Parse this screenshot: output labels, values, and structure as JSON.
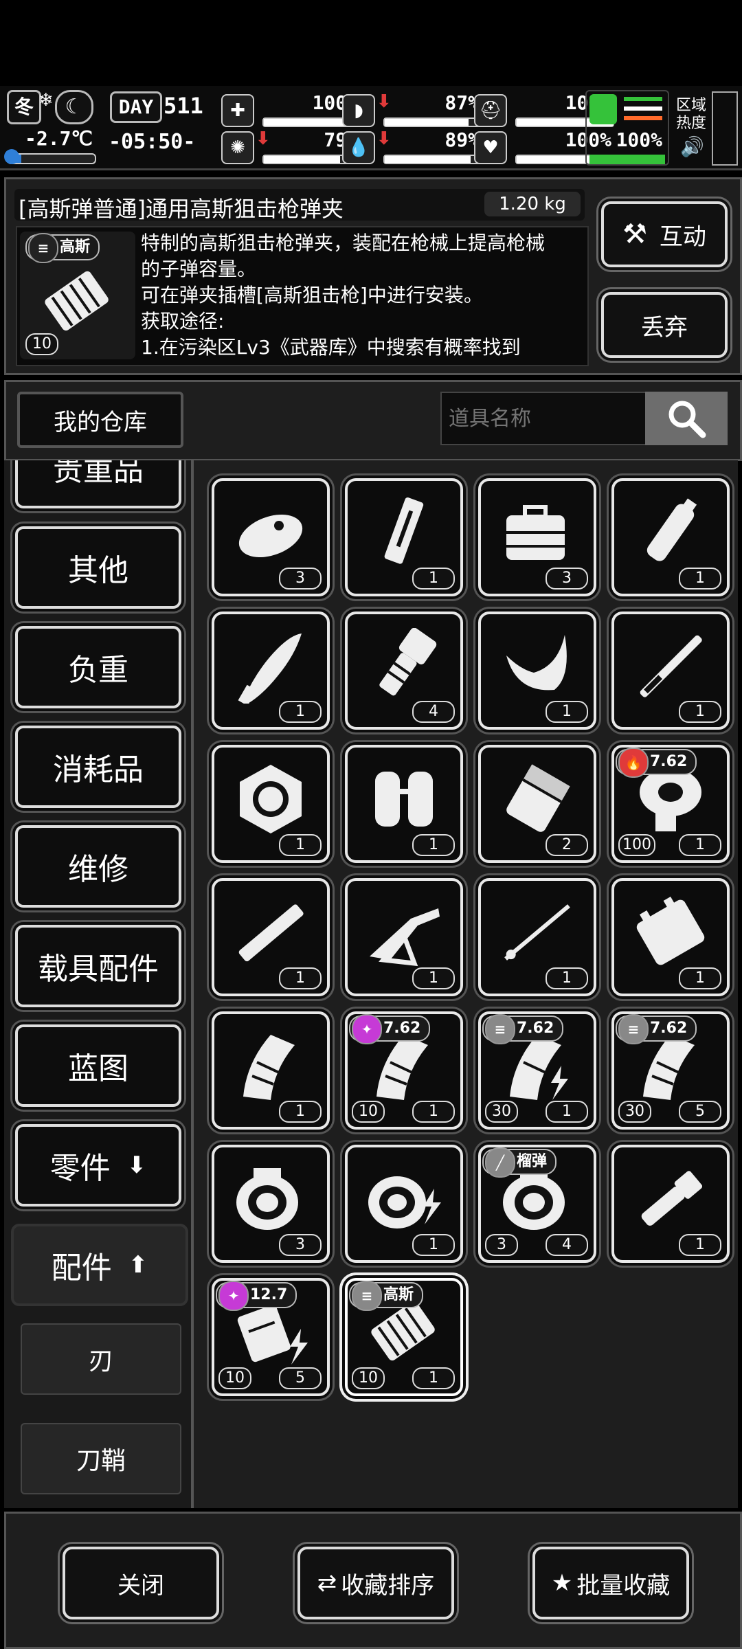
{
  "status": {
    "season": "冬",
    "weather_icon": "snowflake-icon",
    "moon_icon": "crescent-moon-icon",
    "day_label": "DAY",
    "day_number": "511",
    "temperature": "-2.7℃",
    "time": "-05:50-",
    "stats": [
      {
        "name": "health",
        "icon": "medkit-icon",
        "value": "100%",
        "level": 1.0,
        "down": false
      },
      {
        "name": "stomach",
        "icon": "stomach-icon",
        "value": "87%",
        "level": 0.87,
        "down": true
      },
      {
        "name": "defense",
        "icon": "helmet-icon",
        "value": "100%",
        "level": 1.0,
        "down": false
      },
      {
        "name": "mood",
        "icon": "brain-icon",
        "value": "79%",
        "level": 0.79,
        "down": true
      },
      {
        "name": "water",
        "icon": "water-drop-icon",
        "value": "89%",
        "level": 0.89,
        "down": true
      },
      {
        "name": "heart",
        "icon": "heart-icon",
        "value": "100%",
        "level": 1.0,
        "down": false
      }
    ],
    "stamina_value": "100%",
    "stamina_level": 1.0,
    "region_heat_label": "区域热度",
    "accent": "#35c23a",
    "down_color": "#e03a3a"
  },
  "item_info": {
    "title": "[高斯弹普通]通用高斯狙击枪弹夹",
    "weight": "1.20 kg",
    "tag": "高斯",
    "count": "10",
    "description_lines": [
      "特制的高斯狙击枪弹夹，装配在枪械上提高枪械",
      "的子弹容量。",
      "可在弹夹插槽[高斯狙击枪]中进行安装。",
      "获取途径:",
      "1.在污染区Lv3《武器库》中搜索有概率找到"
    ],
    "interact_label": "互动",
    "discard_label": "丢弃"
  },
  "warehouse": {
    "title": "我的仓库",
    "search_placeholder": "道具名称"
  },
  "categories": [
    {
      "label": "贵重品",
      "partial": true
    },
    {
      "label": "其他"
    },
    {
      "label": "负重"
    },
    {
      "label": "消耗品"
    },
    {
      "label": "维修"
    },
    {
      "label": "载具配件"
    },
    {
      "label": "蓝图"
    },
    {
      "label": "零件",
      "arrow": "down"
    },
    {
      "label": "配件",
      "arrow": "up",
      "selected": true
    }
  ],
  "subcategories": [
    "刃",
    "刀鞘"
  ],
  "items": [
    {
      "icon": "oval-case-icon",
      "qty": "3"
    },
    {
      "icon": "pistol-magazine-icon",
      "qty": "1"
    },
    {
      "icon": "toolbox-icon",
      "qty": "3"
    },
    {
      "icon": "suppressor-icon",
      "qty": "1"
    },
    {
      "icon": "curved-blade-icon",
      "qty": "1"
    },
    {
      "icon": "flashlight-icon",
      "qty": "4"
    },
    {
      "icon": "curved-guard-icon",
      "qty": "1"
    },
    {
      "icon": "katana-blade-icon",
      "qty": "1"
    },
    {
      "icon": "weight-plate-icon",
      "qty": "1"
    },
    {
      "icon": "tank-pack-icon",
      "qty": "1"
    },
    {
      "icon": "pouch-icon",
      "qty": "2"
    },
    {
      "icon": "drum-magazine-icon",
      "qty": "1",
      "dur": "100",
      "tag": "7.62",
      "tag_icon": "fire-icon",
      "tag_color": "#e03a3a"
    },
    {
      "icon": "tube-icon",
      "qty": "1"
    },
    {
      "icon": "rifle-stock-icon",
      "qty": "1"
    },
    {
      "icon": "thin-rod-icon",
      "qty": "1"
    },
    {
      "icon": "battery-pack-icon",
      "qty": "1"
    },
    {
      "icon": "curved-magazine-icon",
      "qty": "1"
    },
    {
      "icon": "curved-magazine-icon",
      "qty": "1",
      "dur": "10",
      "tag": "7.62",
      "tag_icon": "purple-bullet-icon",
      "tag_color": "#c63ad6"
    },
    {
      "icon": "curved-magazine-lightning-icon",
      "qty": "1",
      "dur": "30",
      "tag": "7.62",
      "tag_icon": "bullets-icon",
      "tag_color": "#888888"
    },
    {
      "icon": "curved-magazine-icon",
      "qty": "5",
      "dur": "30",
      "tag": "7.62",
      "tag_icon": "bullets-icon",
      "tag_color": "#888888"
    },
    {
      "icon": "scope-ring-icon",
      "qty": "3"
    },
    {
      "icon": "scope-ring-lightning-icon",
      "qty": "1"
    },
    {
      "icon": "scope-ring-icon",
      "qty": "4",
      "dur": "3",
      "tag": "榴弹",
      "tag_icon": "grenade-round-icon",
      "tag_color": "#888888"
    },
    {
      "icon": "flashlight-small-icon",
      "qty": "1"
    },
    {
      "icon": "box-magazine-lightning-icon",
      "qty": "5",
      "dur": "10",
      "tag": "12.7",
      "tag_icon": "purple-bullet-icon",
      "tag_color": "#c63ad6"
    },
    {
      "icon": "gauss-magazine-icon",
      "qty": "1",
      "dur": "10",
      "tag": "高斯",
      "tag_icon": "bullets-icon",
      "tag_color": "#888888",
      "selected": true
    }
  ],
  "bottom": {
    "close_label": "关闭",
    "sort_label": "收藏排序",
    "batch_label": "批量收藏"
  }
}
